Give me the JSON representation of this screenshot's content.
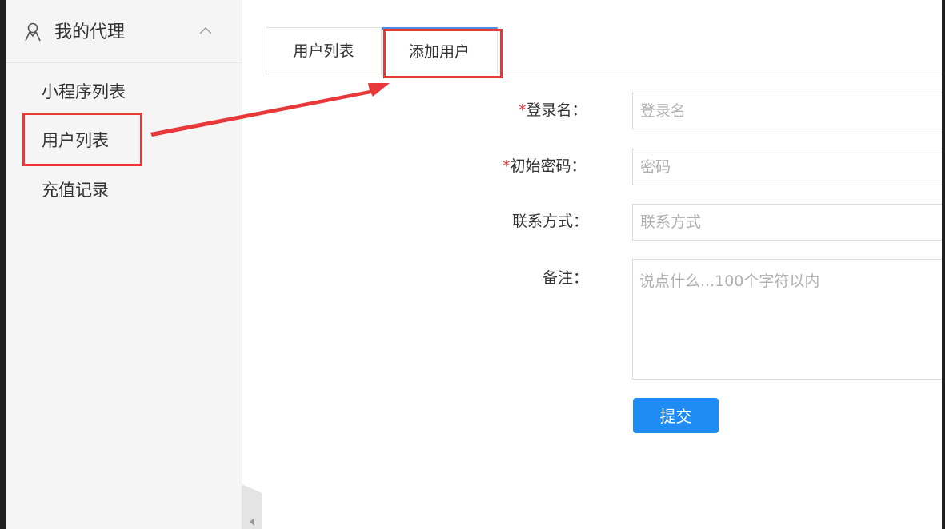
{
  "sidebar": {
    "title": "我的代理",
    "items": [
      {
        "label": "小程序列表"
      },
      {
        "label": "用户列表"
      },
      {
        "label": "充值记录"
      }
    ]
  },
  "tabs": [
    {
      "label": "用户列表",
      "active": false
    },
    {
      "label": "添加用户",
      "active": true
    }
  ],
  "form": {
    "login": {
      "required_mark": "*",
      "label": "登录名：",
      "placeholder": "登录名",
      "value": ""
    },
    "password": {
      "required_mark": "*",
      "label": "初始密码：",
      "placeholder": "密码",
      "value": ""
    },
    "contact": {
      "label": "联系方式：",
      "placeholder": "联系方式",
      "value": ""
    },
    "note": {
      "label": "备注：",
      "placeholder": "说点什么...100个字符以内",
      "value": ""
    },
    "submit_label": "提交"
  },
  "colors": {
    "annotation_red": "#e8383a",
    "accent_blue": "#1e8cf2",
    "tab_active_border": "#4e8ce4"
  },
  "icons": {
    "sidebar_header": "user-icon",
    "sidebar_toggle": "chevron-up-icon",
    "collapse": "collapse-left-icon"
  }
}
